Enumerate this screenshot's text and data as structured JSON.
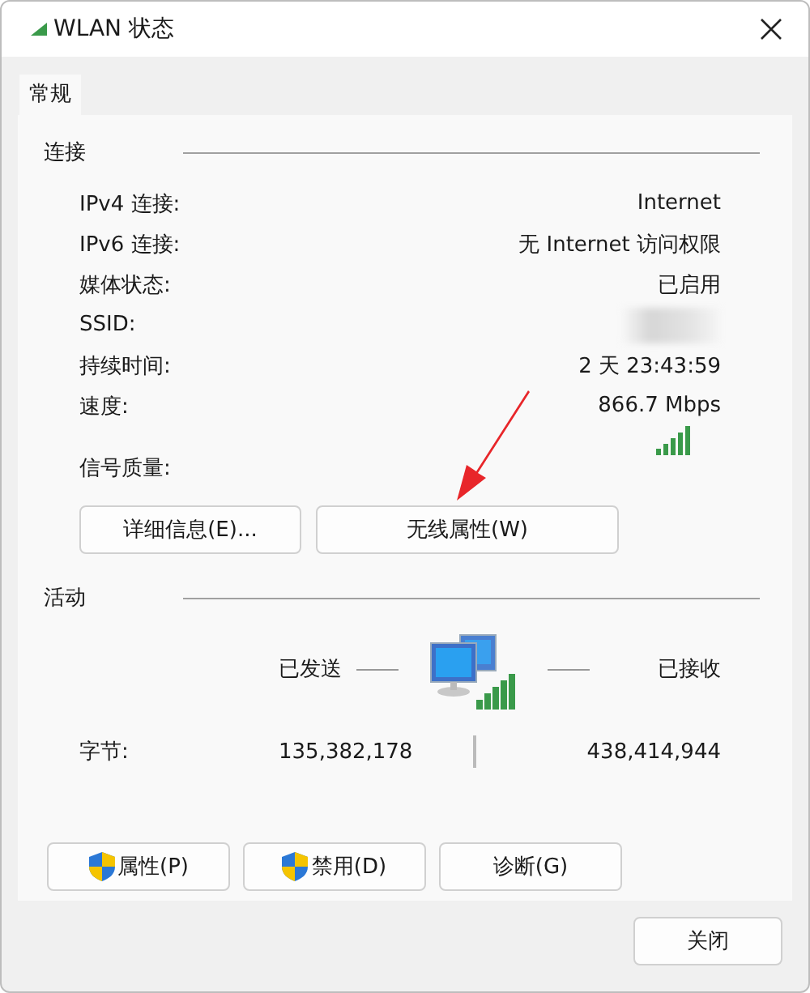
{
  "window": {
    "title": "WLAN 状态"
  },
  "tabs": [
    {
      "label": "常规",
      "selected": true
    }
  ],
  "connection": {
    "heading": "连接",
    "rows": [
      {
        "kind": "text",
        "label": "IPv4 连接:",
        "value": "Internet"
      },
      {
        "kind": "text",
        "label": "IPv6 连接:",
        "value": "无 Internet 访问权限"
      },
      {
        "kind": "text",
        "label": "媒体状态:",
        "value": "已启用"
      },
      {
        "kind": "blurred",
        "label": "SSID:"
      },
      {
        "kind": "text",
        "label": "持续时间:",
        "value": "2 天 23:43:59"
      },
      {
        "kind": "text",
        "label": "速度:",
        "value": "866.7 Mbps"
      },
      {
        "kind": "signal",
        "label": "信号质量:"
      }
    ],
    "buttons": [
      "详细信息(E)...",
      "无线属性(W)"
    ]
  },
  "activity": {
    "heading": "活动",
    "sent_label": "已发送",
    "received_label": "已接收",
    "bytes_label": "字节:",
    "bytes_sent": "135,382,178",
    "bytes_received": "438,414,944",
    "buttons": [
      {
        "label": "属性(P)",
        "shield": true
      },
      {
        "label": "禁用(D)",
        "shield": true
      },
      {
        "label": "诊断(G)",
        "shield": false
      }
    ]
  },
  "close_button": "关闭"
}
